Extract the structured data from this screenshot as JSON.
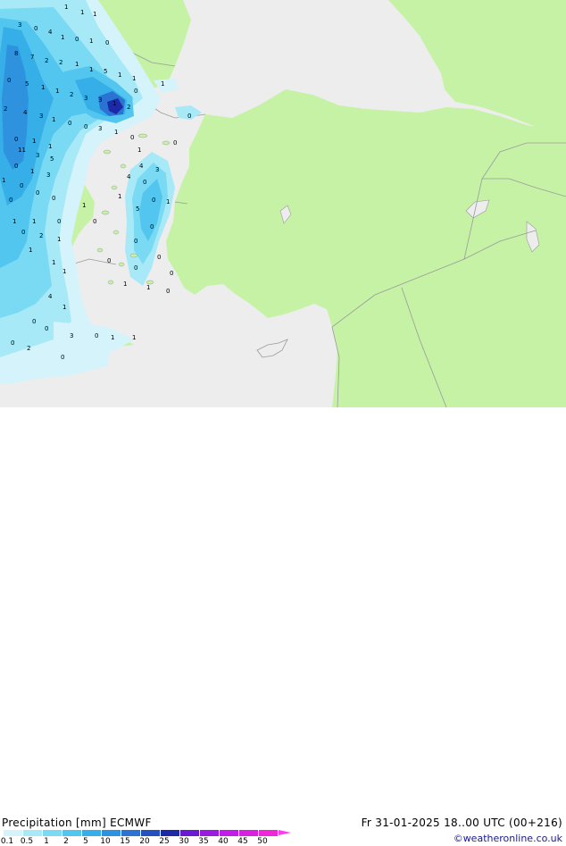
{
  "header": {
    "title": "Precipitation [mm] ECMWF",
    "validity": "Fr 31-01-2025 18..00 UTC (00+216)",
    "credit": "©weatheronline.co.uk"
  },
  "legend": {
    "ticks": [
      "0.1",
      "0.5",
      "1",
      "2",
      "5",
      "10",
      "15",
      "20",
      "25",
      "30",
      "35",
      "40",
      "45",
      "50"
    ],
    "colors": [
      "#d4f3fb",
      "#a8e9f8",
      "#7ad9f3",
      "#52c6ee",
      "#36aee8",
      "#2f92de",
      "#2a73d2",
      "#2450c0",
      "#1c2aa8",
      "#6a1ad0",
      "#9a1ce0",
      "#c01ee8",
      "#d820e0",
      "#ee28d8"
    ],
    "arrow_color": "#ff3cf0"
  },
  "colors": {
    "land": "#c6f2a6",
    "sea": "#ededed",
    "border": "#9a9a9a"
  },
  "map_labels": {
    "values": [
      "1",
      "1",
      "1",
      "3",
      "0",
      "4",
      "1",
      "0",
      "1",
      "0",
      "8",
      "7",
      "2",
      "2",
      "1",
      "1",
      "5",
      "1",
      "1",
      "0",
      "5",
      "1",
      "1",
      "2",
      "3",
      "3",
      "1",
      "2",
      "2",
      "4",
      "3",
      "1",
      "0",
      "0",
      "3",
      "1",
      "0",
      "0",
      "1",
      "1",
      "11",
      "3",
      "5",
      "0",
      "1",
      "3",
      "1",
      "0",
      "0",
      "0",
      "3",
      "4",
      "0",
      "0",
      "1",
      "5",
      "0",
      "0",
      "0",
      "2",
      "0",
      "1",
      "1",
      "1",
      "1",
      "0",
      "1",
      "1",
      "4",
      "1",
      "0",
      "0",
      "3",
      "0",
      "1",
      "0",
      "2",
      "0",
      "1",
      "0",
      "0",
      "0",
      "0",
      "1",
      "1",
      "0",
      "0",
      "1",
      "0",
      "0",
      "1",
      "4",
      "1",
      "1",
      "0"
    ]
  }
}
